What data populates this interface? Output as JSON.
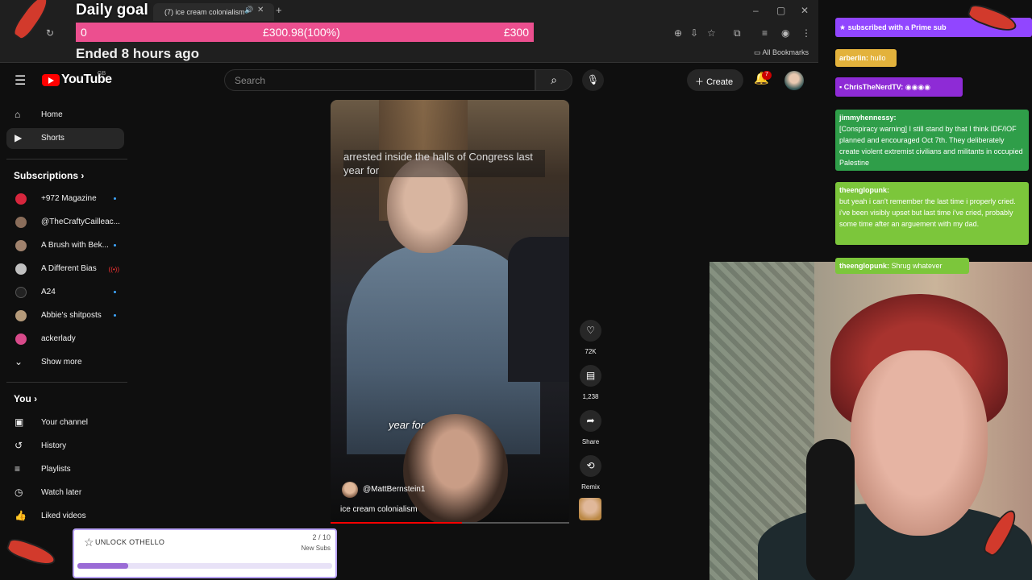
{
  "browser": {
    "tab_title": "(7) ice cream colonialism -",
    "bookmarks_label": "All Bookmarks"
  },
  "goal": {
    "title": "Daily goal",
    "start": "0",
    "current": "£300.98(100%)",
    "target": "£300",
    "progress": 1.0,
    "status": "Ended 8 hours ago",
    "color": "#ec4f8f"
  },
  "youtube": {
    "logo": "YouTube",
    "region": "GB",
    "search_placeholder": "Search",
    "create_label": "Create",
    "notifications": "7"
  },
  "sidebar": {
    "main": [
      {
        "label": "Home",
        "icon": "home-icon"
      },
      {
        "label": "Shorts",
        "icon": "shorts-icon",
        "active": true
      }
    ],
    "subscriptions_heading": "Subscriptions",
    "subscriptions": [
      {
        "label": "+972 Magazine",
        "color": "#d7263d",
        "indicator": "dot"
      },
      {
        "label": "@TheCraftyCailleac...",
        "color": "#8a6d5a",
        "indicator": ""
      },
      {
        "label": "A Brush with Bek...",
        "color": "#a0826d",
        "indicator": "dot"
      },
      {
        "label": "A Different Bias",
        "color": "#c0c0c0",
        "indicator": "live"
      },
      {
        "label": "A24",
        "color": "#222222",
        "indicator": "dot"
      },
      {
        "label": "Abbie's shitposts",
        "color": "#b59a7a",
        "indicator": "dot"
      },
      {
        "label": "ackerlady",
        "color": "#d84a8a",
        "indicator": ""
      }
    ],
    "show_more": "Show more",
    "you_heading": "You",
    "you_items": [
      {
        "label": "Your channel",
        "icon": "channel-icon"
      },
      {
        "label": "History",
        "icon": "history-icon"
      },
      {
        "label": "Playlists",
        "icon": "playlists-icon"
      },
      {
        "label": "Watch later",
        "icon": "watch-later-icon"
      },
      {
        "label": "Liked videos",
        "icon": "liked-icon"
      }
    ]
  },
  "short": {
    "caption_top": "arrested inside the halls of Congress last year for",
    "caption_mid": "year for",
    "channel": "@MattBernstein1",
    "title": "ice cream colonialism",
    "progress": 0.55,
    "likes": "72K",
    "comments": "1,238",
    "share": "Share",
    "remix": "Remix"
  },
  "chat": [
    {
      "user": "",
      "text": "subscribed with a Prime sub",
      "bg": "#9146ff"
    },
    {
      "user": "arberlin:",
      "text": "hullo",
      "bg": "#e3b23c"
    },
    {
      "user": "ChrisTheNerdTV:",
      "text": "",
      "bg": "#8e2bd6"
    },
    {
      "user": "jimmyhennessy:",
      "text": "[Conspiracy warning] I still stand by that I think IDF/IOF planned and encouraged Oct 7th. They deliberately create violent extremist civilians and militants in occupied Palestine",
      "bg": "#2f9e49"
    },
    {
      "user": "theenglopunk:",
      "text": "but yeah i can't remember the last time i properly cried. i've been visibly upset but last time i've cried, probably some time after an arguement with my dad.",
      "bg": "#7cc63b"
    },
    {
      "user": "theenglopunk:",
      "text": "Shrug whatever",
      "bg": "#7cc63b"
    }
  ],
  "unlock": {
    "label": "UNLOCK OTHELLO",
    "count": "2 / 10",
    "sub_label": "New Subs",
    "progress": 0.2
  }
}
